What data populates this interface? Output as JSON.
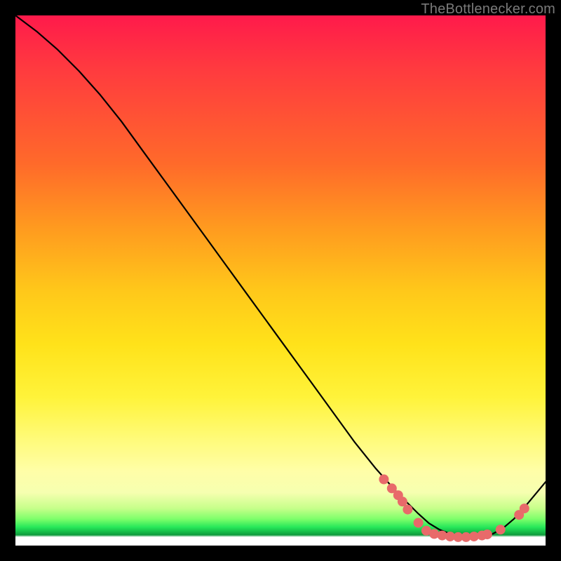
{
  "attribution": "TheBottlenecker.com",
  "colors": {
    "page_bg": "#000000",
    "gradient_top": "#ff1a4b",
    "gradient_mid": "#ffe21a",
    "gradient_green": "#17c24a",
    "curve": "#000000",
    "dot": "#e86a6a",
    "attribution_text": "#7a7a7a"
  },
  "chart_data": {
    "type": "line",
    "title": "",
    "xlabel": "",
    "ylabel": "",
    "xlim": [
      0,
      100
    ],
    "ylim": [
      0,
      100
    ],
    "series": [
      {
        "name": "curve",
        "x": [
          0,
          4,
          8,
          12,
          16,
          20,
          24,
          28,
          32,
          36,
          40,
          44,
          48,
          52,
          56,
          60,
          64,
          68,
          72,
          74,
          76,
          78,
          80,
          82,
          84,
          86,
          88,
          90,
          92,
          94,
          96,
          98,
          100
        ],
        "y": [
          100,
          97,
          93.5,
          89.5,
          85,
          80,
          74.5,
          69,
          63.5,
          58,
          52.5,
          47,
          41.5,
          36,
          30.5,
          25,
          19.5,
          14.5,
          10,
          8,
          6,
          4.2,
          3,
          2.2,
          1.8,
          1.6,
          1.7,
          2.2,
          3.3,
          5,
          7.2,
          9.6,
          12
        ]
      }
    ],
    "markers": [
      {
        "x": 69.5,
        "y": 12.5
      },
      {
        "x": 71.0,
        "y": 10.8
      },
      {
        "x": 72.2,
        "y": 9.5
      },
      {
        "x": 73.0,
        "y": 8.3
      },
      {
        "x": 74.0,
        "y": 6.8
      },
      {
        "x": 76.0,
        "y": 4.3
      },
      {
        "x": 77.5,
        "y": 2.8
      },
      {
        "x": 79.0,
        "y": 2.2
      },
      {
        "x": 80.5,
        "y": 1.9
      },
      {
        "x": 82.0,
        "y": 1.7
      },
      {
        "x": 83.5,
        "y": 1.6
      },
      {
        "x": 85.0,
        "y": 1.6
      },
      {
        "x": 86.5,
        "y": 1.7
      },
      {
        "x": 88.0,
        "y": 1.9
      },
      {
        "x": 89.0,
        "y": 2.1
      },
      {
        "x": 91.5,
        "y": 3.0
      },
      {
        "x": 95.0,
        "y": 5.8
      },
      {
        "x": 96.0,
        "y": 7.0
      }
    ]
  }
}
